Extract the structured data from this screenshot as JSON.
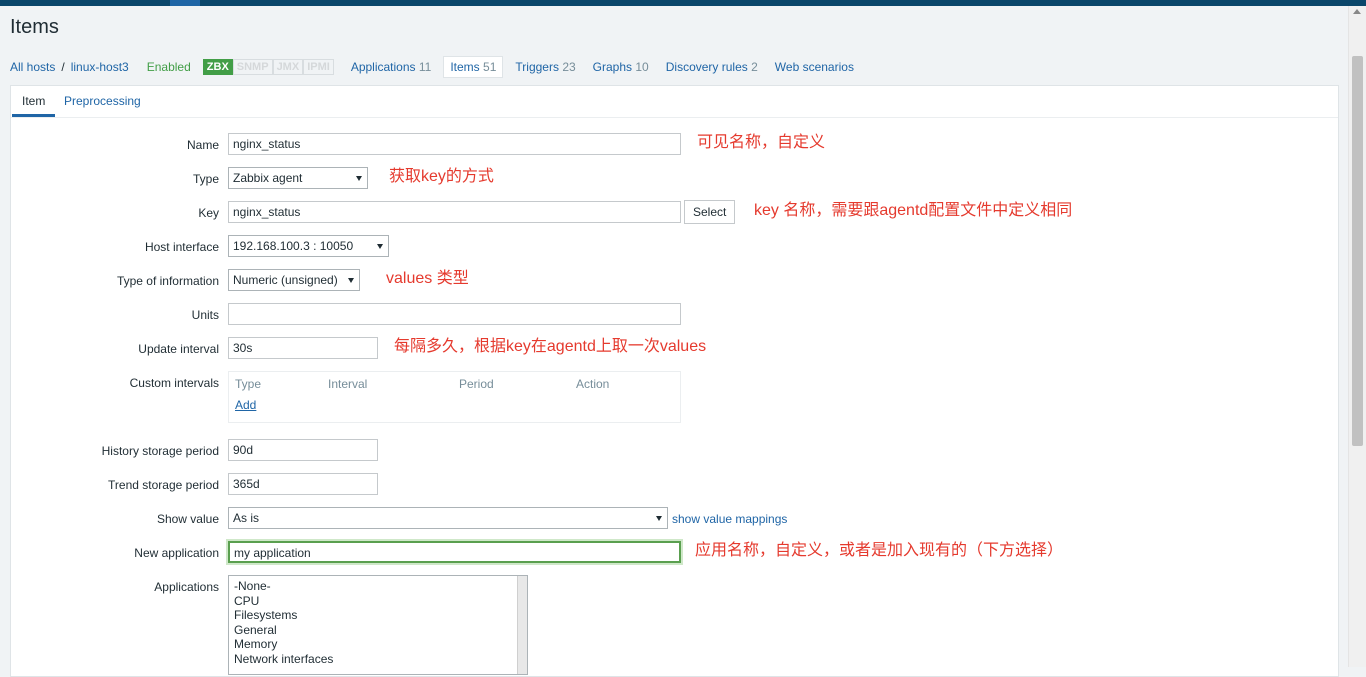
{
  "page": {
    "title": "Items"
  },
  "breadcrumbs": {
    "all_hosts": "All hosts",
    "separator": "/",
    "host": "linux-host3",
    "status": "Enabled",
    "availability": [
      "ZBX",
      "SNMP",
      "JMX",
      "IPMI"
    ],
    "links": [
      {
        "label": "Applications",
        "count": "11"
      },
      {
        "label": "Items",
        "count": "51"
      },
      {
        "label": "Triggers",
        "count": "23"
      },
      {
        "label": "Graphs",
        "count": "10"
      },
      {
        "label": "Discovery rules",
        "count": "2"
      },
      {
        "label": "Web scenarios",
        "count": ""
      }
    ]
  },
  "tabs": [
    "Item",
    "Preprocessing"
  ],
  "form": {
    "name": {
      "label": "Name",
      "value": "nginx_status"
    },
    "type": {
      "label": "Type",
      "value": "Zabbix agent"
    },
    "key": {
      "label": "Key",
      "value": "nginx_status",
      "button": "Select"
    },
    "host_interface": {
      "label": "Host interface",
      "value": "192.168.100.3 : 10050"
    },
    "type_of_information": {
      "label": "Type of information",
      "value": "Numeric (unsigned)"
    },
    "units": {
      "label": "Units",
      "value": ""
    },
    "update_interval": {
      "label": "Update interval",
      "value": "30s"
    },
    "custom_intervals": {
      "label": "Custom intervals",
      "headers": [
        "Type",
        "Interval",
        "Period",
        "Action"
      ],
      "add": "Add"
    },
    "history": {
      "label": "History storage period",
      "value": "90d"
    },
    "trend": {
      "label": "Trend storage period",
      "value": "365d"
    },
    "show_value": {
      "label": "Show value",
      "value": "As is",
      "link": "show value mappings"
    },
    "new_application": {
      "label": "New application",
      "value": "my application"
    },
    "applications": {
      "label": "Applications",
      "options": [
        "-None-",
        "CPU",
        "Filesystems",
        "General",
        "Memory",
        "Network interfaces"
      ]
    }
  },
  "annotations": {
    "name": "可见名称，自定义",
    "type": "获取key的方式",
    "key": "key 名称，需要跟agentd配置文件中定义相同",
    "type_of_information": "values 类型",
    "update_interval": "每隔多久，根据key在agentd上取一次values",
    "new_application": "应用名称，自定义，或者是加入现有的（下方选择）"
  },
  "colors": {
    "accent": "#1f65a6",
    "annotation": "#e53a2e",
    "enabled": "#429e47",
    "topbar": "#0a466a"
  }
}
